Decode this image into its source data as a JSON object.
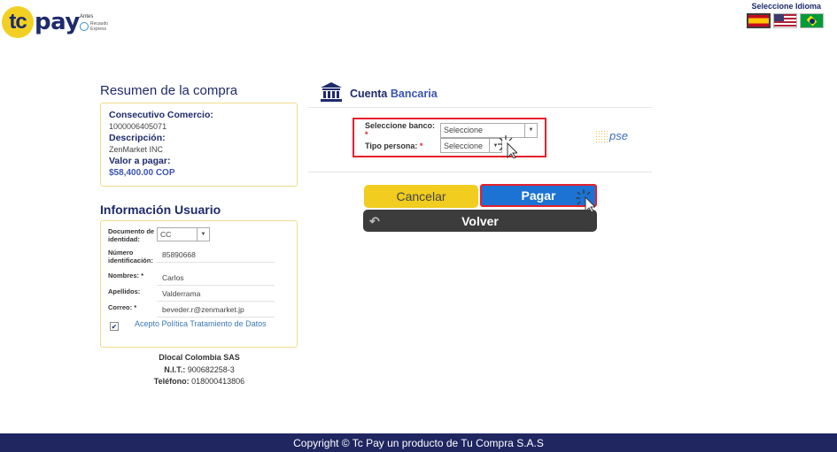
{
  "header": {
    "logo_tc": "tc",
    "logo_pay": "pay",
    "antes_label": "Antes",
    "recaudo_label": "Recaudo Express",
    "language_label": "Seleccione Idioma",
    "flags": [
      "spain-flag",
      "usa-flag",
      "brazil-flag"
    ]
  },
  "summary": {
    "title": "Resumen de la compra",
    "consecutivo_label": "Consecutivo Comercio:",
    "consecutivo_value": "1000006405071",
    "descripcion_label": "Descripción:",
    "descripcion_value": "ZenMarket INC",
    "valor_label": "Valor a pagar:",
    "valor_value": "$58,400.00 COP"
  },
  "user": {
    "title": "Información Usuario",
    "doc_label": "Documento de identidad:",
    "doc_value": "CC",
    "numero_label": "Número identificación:",
    "numero_value": "85890668",
    "nombres_label": "Nombres:",
    "nombres_value": "Carlos",
    "apellidos_label": "Apellidos:",
    "apellidos_value": "Valderrama",
    "correo_label": "Correo:",
    "correo_value": "beveder.r@zenmarket.jp",
    "required_mark": "*",
    "policy_label": "Acepto Política Tratamiento de Datos",
    "policy_checked": true
  },
  "company": {
    "name": "Dlocal Colombia SAS",
    "nit_label": "N.I.T.:",
    "nit_value": "900682258-3",
    "tel_label": "Teléfono:",
    "tel_value": "018000413806"
  },
  "bank": {
    "title_part1": "Cuenta",
    "title_part2": "Bancaria",
    "banco_label": "Seleccione banco:",
    "banco_value": "Seleccione",
    "persona_label": "Tipo persona:",
    "persona_value": "Seleccione",
    "required_mark": "*",
    "pse_label": "pse"
  },
  "buttons": {
    "cancel": "Cancelar",
    "pay": "Pagar",
    "back": "Volver"
  },
  "footer": {
    "copyright": "Copyright © Tc Pay un producto de Tu Compra S.A.S"
  },
  "colors": {
    "brand_navy": "#1e2a6b",
    "brand_yellow": "#f2d023",
    "pay_blue": "#1c73d4",
    "highlight_red": "#e5202e",
    "footer_bg": "#1f2660"
  }
}
